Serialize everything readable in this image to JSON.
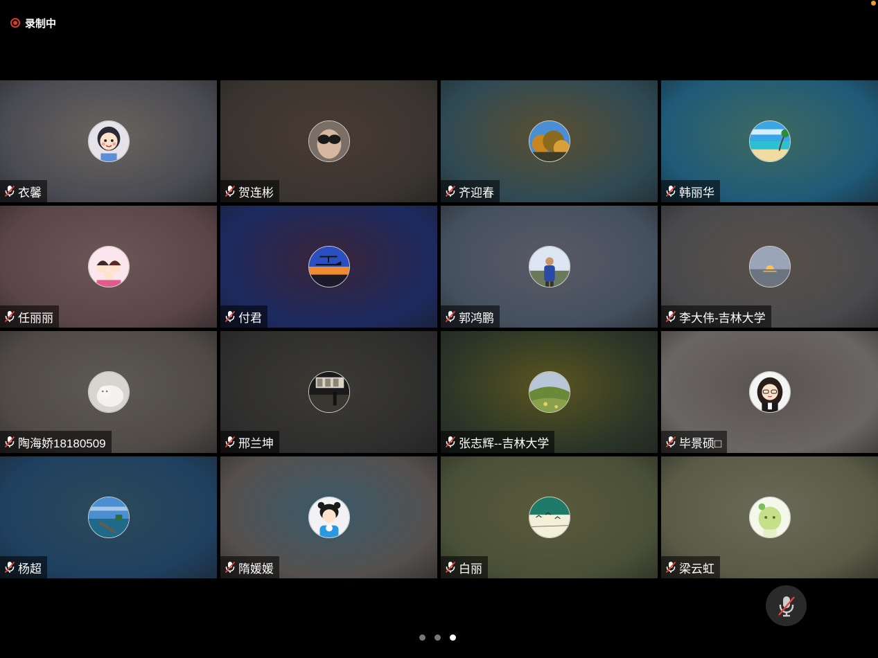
{
  "recording": {
    "label": "录制中",
    "color": "#d83a30"
  },
  "icons": {
    "muted_mic": "mic-muted-icon",
    "record": "record-icon"
  },
  "participants": [
    {
      "name": "衣馨",
      "muted": true,
      "bg": [
        "#4a4b52",
        "#6a645e"
      ],
      "avatar": "cartoon-girl"
    },
    {
      "name": "贺连彬",
      "muted": true,
      "bg": [
        "#3a3530",
        "#4a3a32"
      ],
      "avatar": "sunglasses-face"
    },
    {
      "name": "齐迎春",
      "muted": true,
      "bg": [
        "#2f4a55",
        "#5a4f30"
      ],
      "avatar": "autumn-trees"
    },
    {
      "name": "韩丽华",
      "muted": true,
      "bg": [
        "#1f5a78",
        "#3f6a60"
      ],
      "avatar": "beach"
    },
    {
      "name": "任丽丽",
      "muted": true,
      "bg": [
        "#5a4548",
        "#6b5658"
      ],
      "avatar": "cartoon-couple"
    },
    {
      "name": "付君",
      "muted": true,
      "bg": [
        "#1c2a60",
        "#3a2438"
      ],
      "avatar": "aircraft-sunset"
    },
    {
      "name": "郭鸿鹏",
      "muted": true,
      "bg": [
        "#44505e",
        "#5a5a66"
      ],
      "avatar": "man-outdoor"
    },
    {
      "name": "李大伟-吉林大学",
      "muted": true,
      "bg": [
        "#4a4a4c",
        "#58504a"
      ],
      "avatar": "sunset-sea"
    },
    {
      "name": "陶海娇18180509",
      "muted": true,
      "bg": [
        "#4f4a46",
        "#5d5955"
      ],
      "avatar": "white-cat"
    },
    {
      "name": "邢兰坤",
      "muted": true,
      "bg": [
        "#2e2e2e",
        "#3c3a34"
      ],
      "avatar": "night-street"
    },
    {
      "name": "张志辉--吉林大学",
      "muted": true,
      "bg": [
        "#2a3528",
        "#5a5520"
      ],
      "avatar": "grass-hill"
    },
    {
      "name": "毕景硕□",
      "muted": true,
      "bg": [
        "#6a6664",
        "#585250"
      ],
      "avatar": "cartoon-woman"
    },
    {
      "name": "杨超",
      "muted": true,
      "bg": [
        "#1f4060",
        "#2c4a5a"
      ],
      "avatar": "pier-sea"
    },
    {
      "name": "隋媛媛",
      "muted": true,
      "bg": [
        "#55504e",
        "#3a5a6a"
      ],
      "avatar": "girl-buns"
    },
    {
      "name": "白丽",
      "muted": true,
      "bg": [
        "#4a5038",
        "#5a5a3a"
      ],
      "avatar": "birds-sky"
    },
    {
      "name": "梁云虹",
      "muted": true,
      "bg": [
        "#5a5a46",
        "#6a6a58"
      ],
      "avatar": "green-cartoon"
    }
  ],
  "pagination": {
    "total": 3,
    "current": 3
  }
}
